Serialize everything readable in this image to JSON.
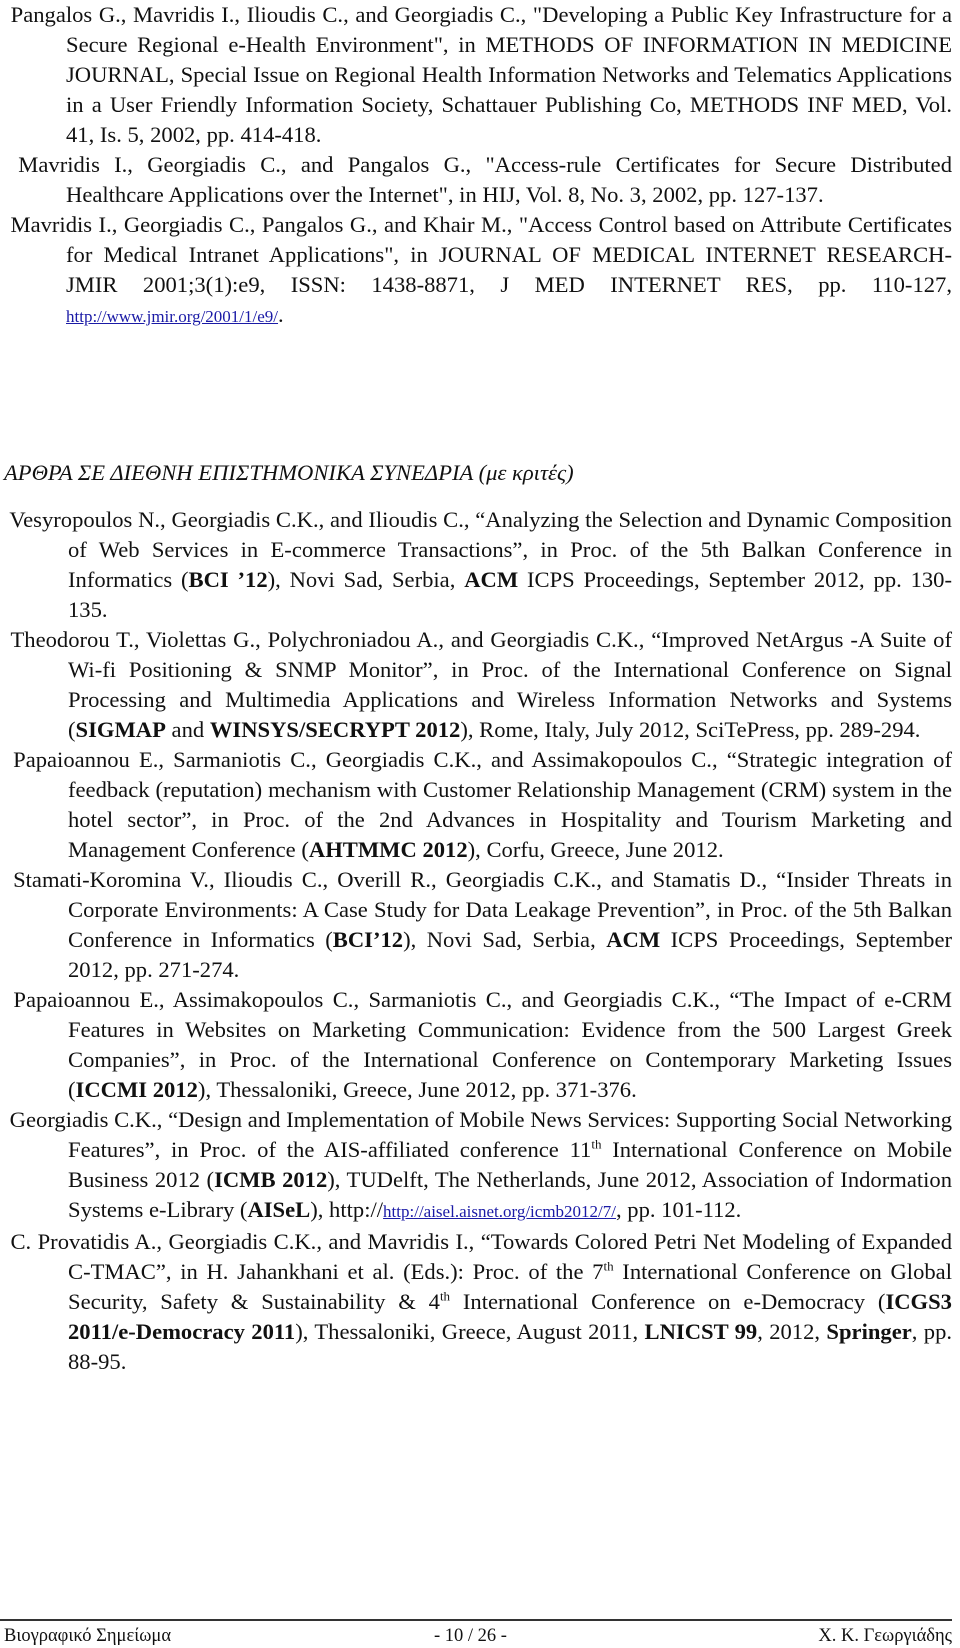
{
  "journal_refs": [
    {
      "id": "J.3.",
      "text": "Pangalos G., Mavridis I., Ilioudis C., and Georgiadis C., \"Developing a Public Key Infrastructure for a Secure Regional e-Health Environment\", in METHODS OF INFORMATION IN MEDICINE JOURNAL, Special Issue on Regional Health Information Networks and Telematics Applications in a User Friendly Information Society, Schattauer Publishing Co, METHODS INF MED, Vol. 41, Is. 5, 2002, pp. 414-418."
    },
    {
      "id": "J.2.",
      "text": "Mavridis I., Georgiadis C., and Pangalos G., \"Access-rule Certificates for Secure Distributed Healthcare Applications over the Internet\", in HIJ, Vol. 8, No. 3, 2002, pp. 127-137."
    },
    {
      "id": "J.1.",
      "text": "Mavridis I., Georgiadis C., Pangalos G., and Khair M., \"Access Control based on Attribute Certificates for Medical Intranet Applications\", in JOURNAL OF MEDICAL INTERNET RESEARCH-JMIR 2001;3(1):e9, ISSN: 1438-8871, J MED INTERNET RES, pp. 110-127, ",
      "link": "http://www.jmir.org/2001/1/e9/",
      "after": "."
    }
  ],
  "section_heading": {
    "main": "ΑΡΘΡΑ ΣΕ ΔΙΕΘΝΗ ΕΠΙΣΤΗΜΟΝΙΚΑ ΣΥΝΕΔΡΙΑ",
    "sub": "(με κριτές)"
  },
  "conference_refs": [
    {
      "id": "C.51.",
      "parts": [
        {
          "t": "Vesyropoulos N., Georgiadis C.K., and Ilioudis C., “Analyzing the Selection and Dynamic Composition of Web Services in E-commerce Transactions”, in Proc. of the 5th Balkan Conference in Informatics ("
        },
        {
          "t": "BCI ’12",
          "b": true
        },
        {
          "t": "), Novi Sad, Serbia, "
        },
        {
          "t": "ACM",
          "b": true
        },
        {
          "t": " ICPS Proceedings, September 2012, pp. 130-135."
        }
      ]
    },
    {
      "id": "C.50.",
      "parts": [
        {
          "t": "Theodorou T., Violettas G., Polychroniadou A., and Georgiadis C.K., “Improved NetArgus -A Suite of Wi-fi Positioning & SNMP Monitor”, in Proc. of the International Conference on Signal Processing and Multimedia Applications and Wireless Information Networks and Systems  ("
        },
        {
          "t": "SIGMAP",
          "b": true
        },
        {
          "t": " and "
        },
        {
          "t": "WINSYS/SECRYPT 2012",
          "b": true
        },
        {
          "t": "), Rome, Italy, July 2012, SciTePress, pp. 289-294."
        }
      ]
    },
    {
      "id": "C.49.",
      "parts": [
        {
          "t": "Papaioannou E., Sarmaniotis C., Georgiadis C.K., and Assimakopoulos C., “Strategic integration of feedback (reputation) mechanism with Customer Relationship Management (CRM) system in the hotel sector”, in Proc. of the 2nd Advances in Hospitality and Tourism Marketing and Management Conference ("
        },
        {
          "t": "AHTMMC 2012",
          "b": true
        },
        {
          "t": "), Corfu, Greece, June 2012."
        }
      ]
    },
    {
      "id": "C.48.",
      "parts": [
        {
          "t": "Stamati-Koromina V., Ilioudis C., Overill R., Georgiadis C.K., and Stamatis D., “Insider Threats in Corporate Environments: A Case Study for Data Leakage Prevention”, in Proc. of the 5th Balkan Conference in Informatics ("
        },
        {
          "t": "BCI’12",
          "b": true
        },
        {
          "t": "), Novi Sad, Serbia, "
        },
        {
          "t": "ACM",
          "b": true
        },
        {
          "t": " ICPS Proceedings, September 2012, pp. 271-274."
        }
      ]
    },
    {
      "id": "C.47.",
      "parts": [
        {
          "t": "Papaioannou E., Assimakopoulos C., Sarmaniotis C., and Georgiadis C.K., “The Impact of e-CRM Features in Websites on Marketing Communication: Evidence from the 500 Largest Greek Companies”, in Proc. of the International Conference on Contemporary Marketing Issues ("
        },
        {
          "t": "ICCMI 2012",
          "b": true
        },
        {
          "t": "), Thessaloniki, Greece, June 2012, pp. 371-376."
        }
      ]
    },
    {
      "id": "C.46.",
      "parts": [
        {
          "t": "Georgiadis C.K., “Design and Implementation of Mobile News Services: Supporting Social Networking Features”, in Proc. of the AIS-affiliated conference 11"
        },
        {
          "t": "th",
          "sup": true
        },
        {
          "t": " International Conference on Mobile Business 2012 ("
        },
        {
          "t": "ICMB 2012",
          "b": true
        },
        {
          "t": "), TUDelft, The Netherlands, June 2012, Association of Indormation Systems e-Library ("
        },
        {
          "t": "AISeL",
          "b": true
        },
        {
          "t": "), http://"
        },
        {
          "t": "http://aisel.aisnet.org/icmb2012/7/",
          "link": true
        },
        {
          "t": ", pp. 101-112."
        }
      ]
    },
    {
      "id": "C.45.",
      "parts": [
        {
          "t": "C. Provatidis A., Georgiadis C.K., and Mavridis I., “Towards Colored Petri Net Modeling of Expanded C-TMAC”, in H. Jahankhani et al. (Eds.): Proc. of the 7"
        },
        {
          "t": "th",
          "sup": true
        },
        {
          "t": " International Conference on Global Security, Safety & Sustainability & 4"
        },
        {
          "t": "th",
          "sup": true
        },
        {
          "t": " International Conference on e-Democracy ("
        },
        {
          "t": "ICGS3 2011/e-Democracy 2011",
          "b": true
        },
        {
          "t": "), Thessaloniki, Greece, August 2011, "
        },
        {
          "t": "LNICST 99",
          "b": true
        },
        {
          "t": ", 2012, "
        },
        {
          "t": "Springer",
          "b": true
        },
        {
          "t": ", pp. 88-95."
        }
      ]
    }
  ],
  "footer": {
    "left": "Βιογραφικό Σημείωμα",
    "page": "- 10 / 26 -",
    "right": "Χ. Κ. Γεωργιάδης"
  },
  "colors": {
    "text": "#111111",
    "link": "#1a1aa6"
  }
}
